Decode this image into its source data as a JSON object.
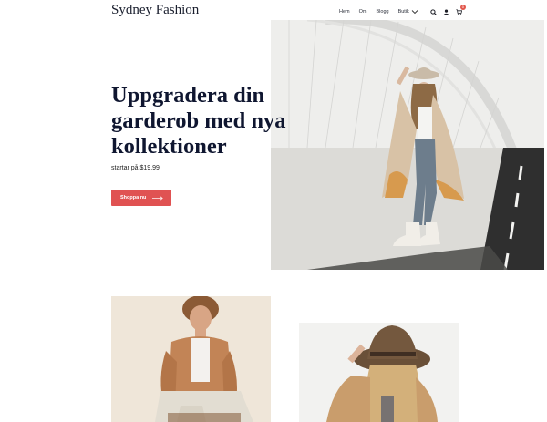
{
  "site": {
    "logo": "Sydney Fashion"
  },
  "nav": {
    "items": [
      "Hem",
      "Om",
      "Blogg"
    ],
    "dropdown_label": "Butik",
    "cart_count": "0"
  },
  "hero": {
    "title": "Uppgradera din garderob med nya kollektioner",
    "subtitle": "startar på $19.99",
    "button_label": "Shoppa nu"
  },
  "colors": {
    "accent": "#e05252",
    "heading": "#0f1630",
    "badge": "#e2574c"
  },
  "icons": [
    "chevron-down-icon",
    "search-icon",
    "user-icon",
    "cart-icon",
    "arrow-right-icon"
  ]
}
